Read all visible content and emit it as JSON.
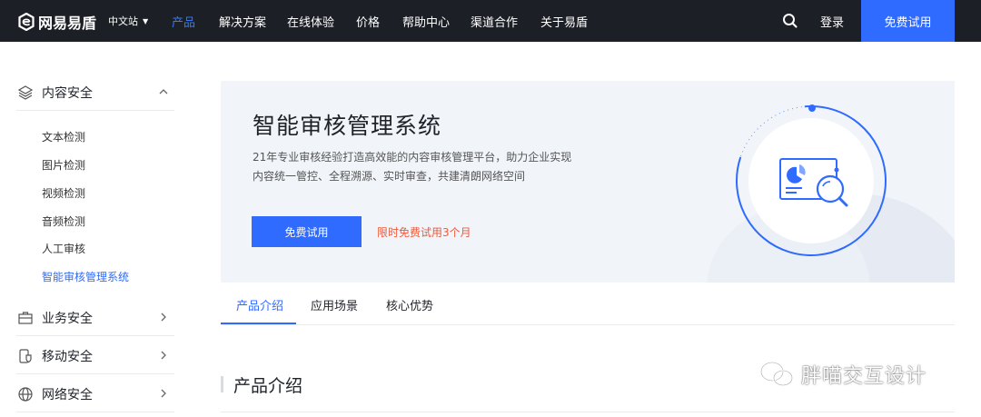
{
  "brand": {
    "name": "网易易盾",
    "logo_icon": "e-logo-icon"
  },
  "topbar": {
    "region": "中文站",
    "nav": [
      "产品",
      "解决方案",
      "在线体验",
      "价格",
      "帮助中心",
      "渠道合作",
      "关于易盾"
    ],
    "active_nav": "产品",
    "login": "登录",
    "trial": "免费试用"
  },
  "sidebar": {
    "groups": [
      {
        "label": "内容安全",
        "icon": "layers-icon",
        "expanded": true
      },
      {
        "label": "业务安全",
        "icon": "briefcase-icon",
        "expanded": false
      },
      {
        "label": "移动安全",
        "icon": "mobile-shield-icon",
        "expanded": false
      },
      {
        "label": "网络安全",
        "icon": "globe-icon",
        "expanded": false
      }
    ],
    "items": [
      "文本检测",
      "图片检测",
      "视频检测",
      "音频检测",
      "人工审核",
      "智能审核管理系统"
    ],
    "active_item": "智能审核管理系统"
  },
  "hero": {
    "title": "智能审核管理系统",
    "desc_line1": "21年专业审核经验打造高效能的内容审核管理平台，助力企业实现",
    "desc_line2": "内容统一管控、全程溯源、实时审查，共建清朗网络空间",
    "button": "免费试用",
    "promo": "限时免费试用3个月"
  },
  "tabs": [
    "产品介绍",
    "应用场景",
    "核心优势"
  ],
  "active_tab": "产品介绍",
  "section": {
    "title": "产品介绍"
  },
  "watermark": "胖喵交互设计",
  "colors": {
    "accent": "#2f6bff",
    "topbar": "#1c1f26",
    "promo": "#f05a3b",
    "hero_bg": "#f1f4f9"
  }
}
